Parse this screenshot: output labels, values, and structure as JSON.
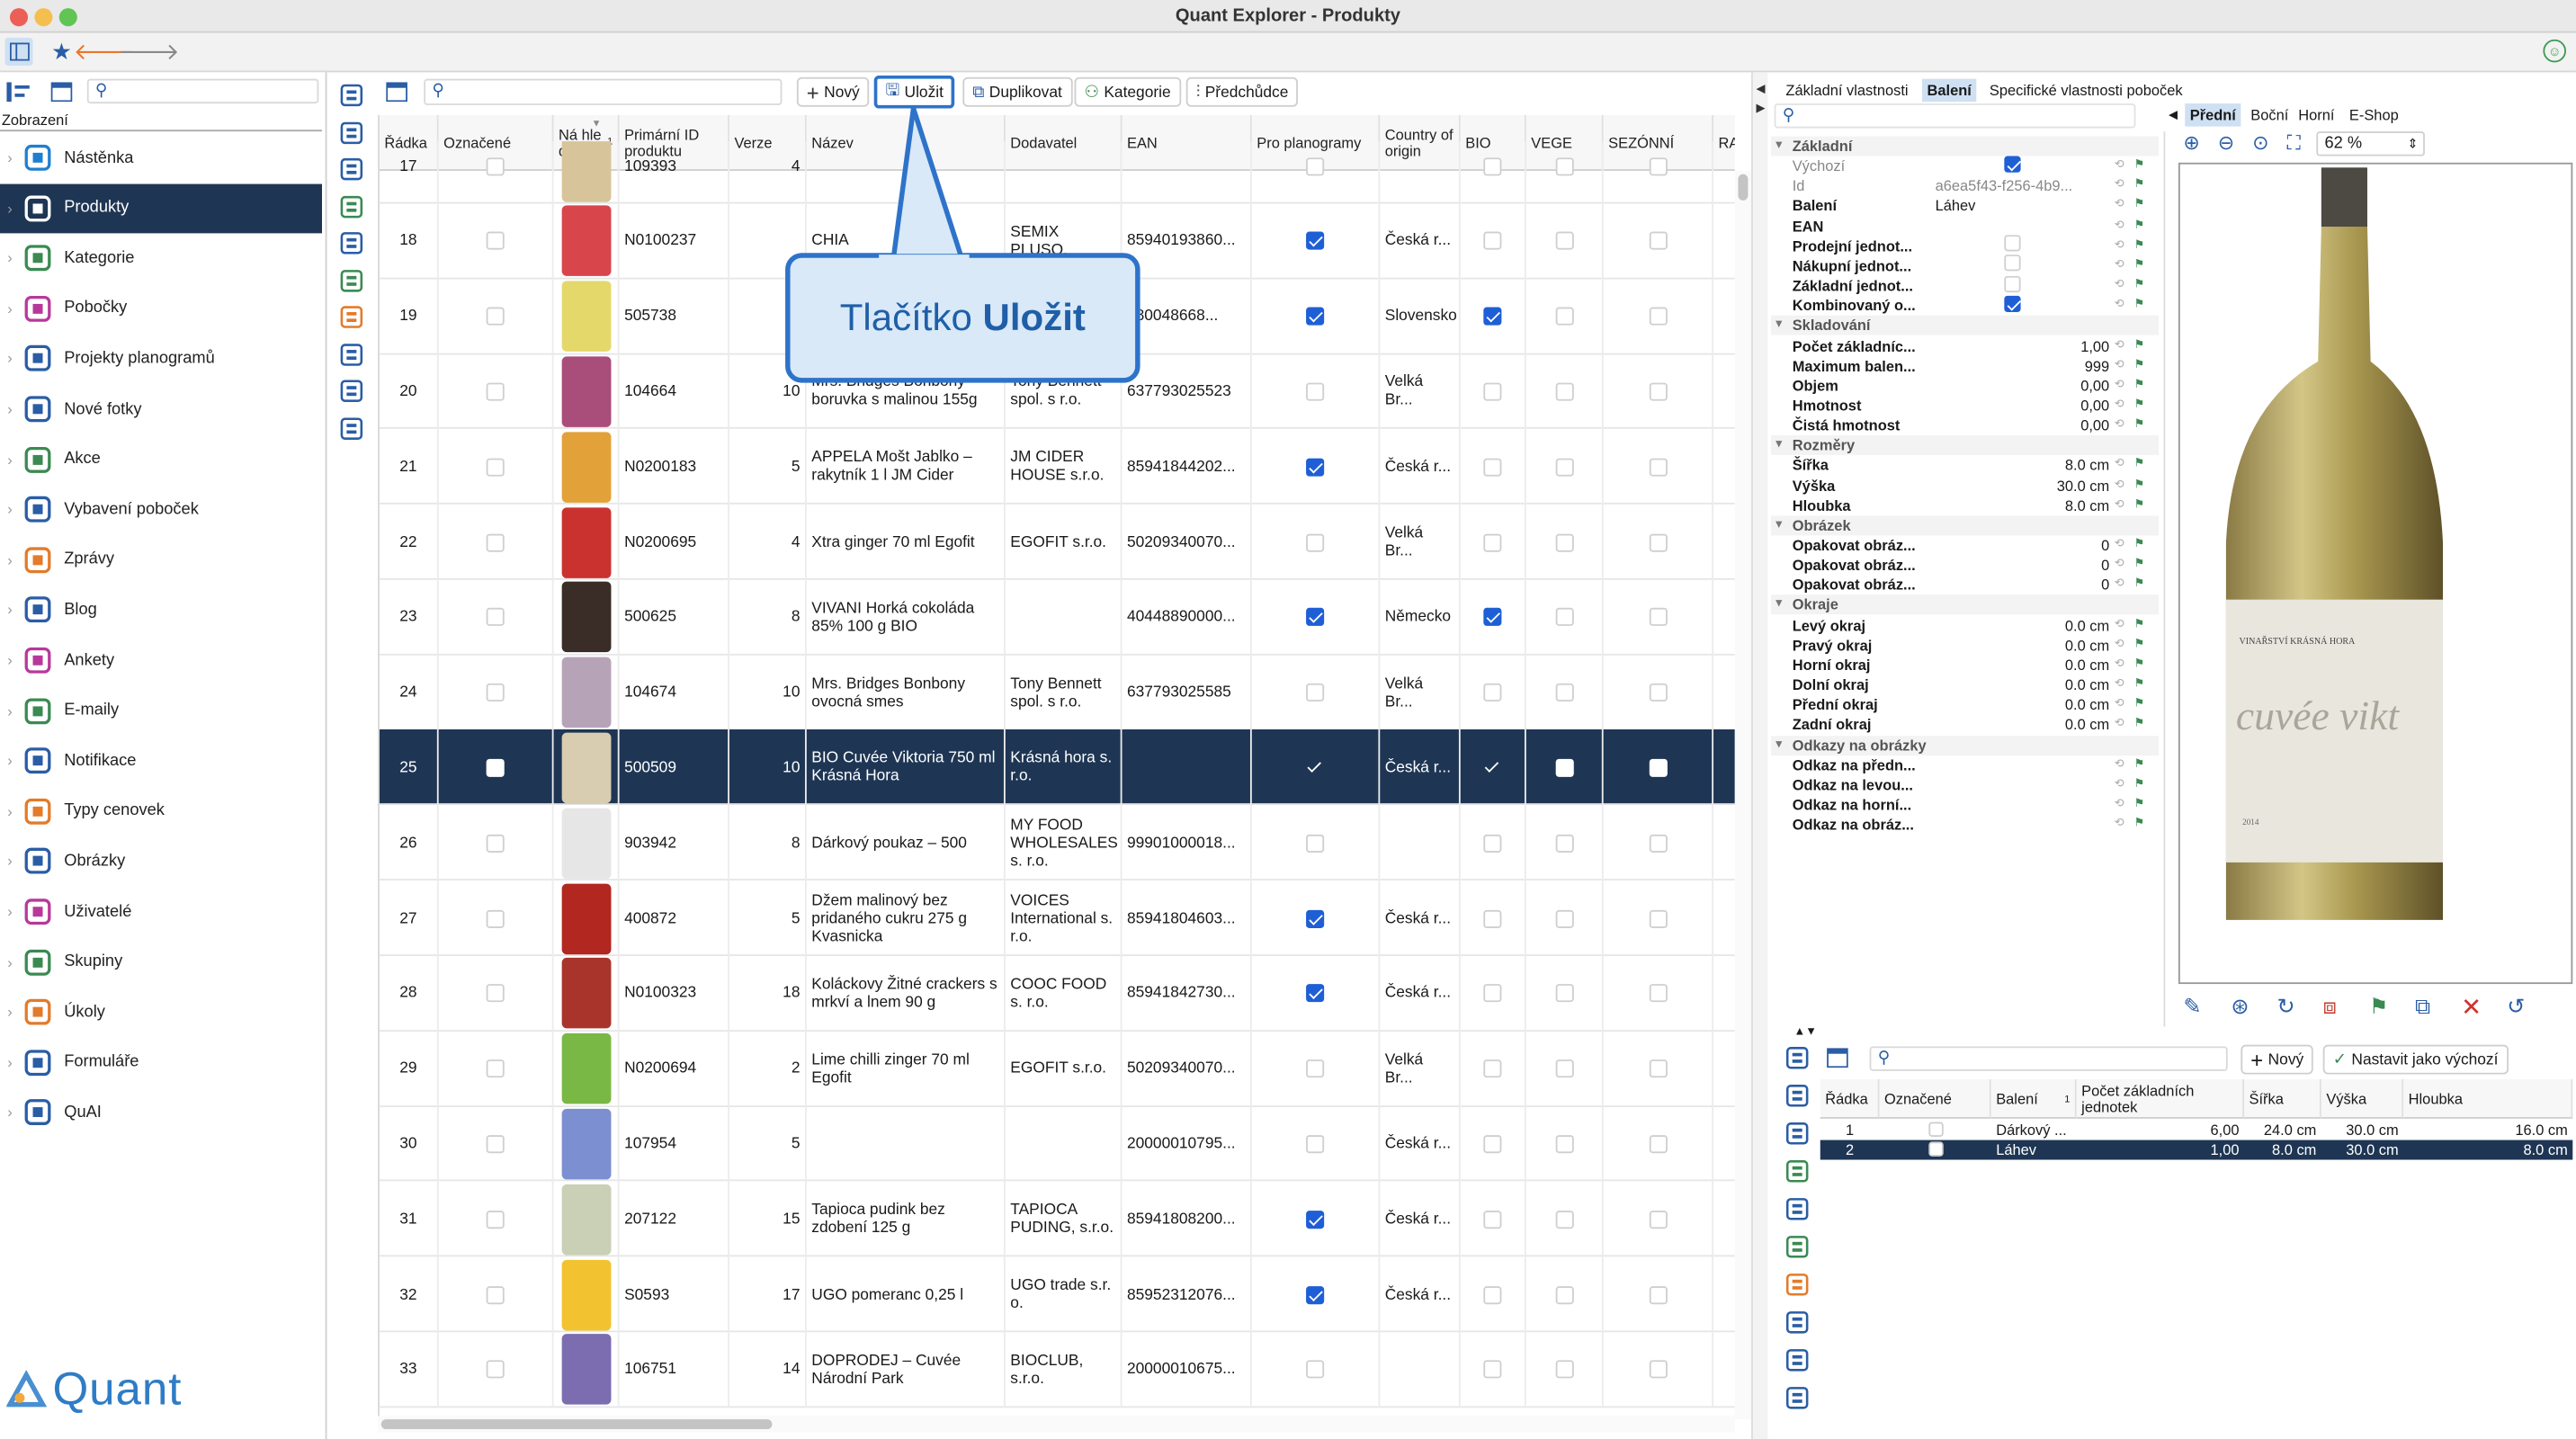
{
  "window": {
    "title": "Quant Explorer - Produkty"
  },
  "sidebar": {
    "section_label": "Zobrazení",
    "logo_text": "Quant",
    "items": [
      {
        "label": "Nástěnka",
        "icon": "dashboard-icon"
      },
      {
        "label": "Produkty",
        "icon": "products-icon",
        "selected": true
      },
      {
        "label": "Kategorie",
        "icon": "categories-icon"
      },
      {
        "label": "Pobočky",
        "icon": "branches-icon"
      },
      {
        "label": "Projekty planogramů",
        "icon": "planogram-icon"
      },
      {
        "label": "Nové fotky",
        "icon": "camera-icon"
      },
      {
        "label": "Akce",
        "icon": "promo-icon"
      },
      {
        "label": "Vybavení poboček",
        "icon": "equipment-icon"
      },
      {
        "label": "Zprávy",
        "icon": "messages-icon"
      },
      {
        "label": "Blog",
        "icon": "blog-icon"
      },
      {
        "label": "Ankety",
        "icon": "survey-icon"
      },
      {
        "label": "E-maily",
        "icon": "email-icon"
      },
      {
        "label": "Notifikace",
        "icon": "notification-icon"
      },
      {
        "label": "Typy cenovek",
        "icon": "price-tag-icon"
      },
      {
        "label": "Obrázky",
        "icon": "image-icon"
      },
      {
        "label": "Uživatelé",
        "icon": "user-icon"
      },
      {
        "label": "Skupiny",
        "icon": "group-icon"
      },
      {
        "label": "Úkoly",
        "icon": "task-icon"
      },
      {
        "label": "Formuláře",
        "icon": "form-icon"
      },
      {
        "label": "QuAI",
        "icon": "ai-icon"
      }
    ]
  },
  "toolbar": {
    "new": "Nový",
    "save": "Uložit",
    "duplicate": "Duplikovat",
    "category": "Kategorie",
    "predecessors": "Předchůdce"
  },
  "callout": {
    "prefix": "Tlačítko ",
    "bold": "Uložit"
  },
  "table": {
    "columns": [
      "Řádka",
      "Označené",
      "Ná hle d",
      "Primární ID produktu",
      "Verze",
      "Název",
      "Dodavatel",
      "EAN",
      "Pro planogramy",
      "Country of origin",
      "BIO",
      "VEGE",
      "SEZÓNNÍ",
      "RA"
    ],
    "sort_indicator": "1",
    "rows": [
      {
        "n": "17",
        "id": "109393",
        "ver": "4",
        "name": "",
        "sup": "",
        "ean": "",
        "plano": false,
        "origin": "",
        "bio": false,
        "thumb": "#d7c49a"
      },
      {
        "n": "18",
        "id": "N0100237",
        "ver": "",
        "name": "CHIA",
        "sup": "SEMIX PLUSO,",
        "ean": "85940193860...",
        "plano": true,
        "origin": "Česká r...",
        "bio": false,
        "thumb": "#d8454b"
      },
      {
        "n": "19",
        "id": "505738",
        "ver": "",
        "name": "",
        "sup": "",
        "ean": "880048668...",
        "plano": true,
        "origin": "Slovensko",
        "bio": true,
        "thumb": "#e4d86a"
      },
      {
        "n": "20",
        "id": "104664",
        "ver": "10",
        "name": "Mrs. Bridges Bonbony boruvka s malinou 155g",
        "sup": "Tony Bennett spol. s r.o.",
        "ean": "637793025523",
        "plano": false,
        "origin": "Velká Br...",
        "bio": false,
        "thumb": "#a94d7a"
      },
      {
        "n": "21",
        "id": "N0200183",
        "ver": "5",
        "name": "APPELA Mošt Jablko – rakytník 1 l JM Cider",
        "sup": "JM CIDER HOUSE s.r.o.",
        "ean": "85941844202...",
        "plano": true,
        "origin": "Česká r...",
        "bio": false,
        "thumb": "#e3a13a"
      },
      {
        "n": "22",
        "id": "N0200695",
        "ver": "4",
        "name": "Xtra ginger 70 ml Egofit",
        "sup": "EGOFIT s.r.o.",
        "ean": "50209340070...",
        "plano": false,
        "origin": "Velká Br...",
        "bio": false,
        "thumb": "#c9322f"
      },
      {
        "n": "23",
        "id": "500625",
        "ver": "8",
        "name": "VIVANI Horká cokoláda 85% 100 g BIO",
        "sup": "",
        "ean": "40448890000...",
        "plano": true,
        "origin": "Německo",
        "bio": true,
        "thumb": "#3a2c27"
      },
      {
        "n": "24",
        "id": "104674",
        "ver": "10",
        "name": "Mrs. Bridges Bonbony ovocná smes",
        "sup": "Tony Bennett spol. s r.o.",
        "ean": "637793025585",
        "plano": false,
        "origin": "Velká Br...",
        "bio": false,
        "thumb": "#b7a3b8"
      },
      {
        "n": "25",
        "id": "500509",
        "ver": "10",
        "name": "BIO Cuvée Viktoria 750 ml Krásná Hora",
        "sup": "Krásná hora s. r.o.",
        "ean": "",
        "plano": true,
        "origin": "Česká r...",
        "bio": true,
        "thumb": "#d8cdb0",
        "selected": true
      },
      {
        "n": "26",
        "id": "903942",
        "ver": "8",
        "name": "Dárkový poukaz – 500",
        "sup": "MY FOOD WHOLESALES s. r.o.",
        "ean": "99901000018...",
        "plano": false,
        "origin": "",
        "bio": false,
        "thumb": "#e6e6e6"
      },
      {
        "n": "27",
        "id": "400872",
        "ver": "5",
        "name": "Džem malinový bez pridaného cukru 275 g Kvasnicka",
        "sup": "VOICES International s. r.o.",
        "ean": "85941804603...",
        "plano": true,
        "origin": "Česká r...",
        "bio": false,
        "thumb": "#b2271f"
      },
      {
        "n": "28",
        "id": "N0100323",
        "ver": "18",
        "name": "Koláckovy Žitné crackers s mrkví a lnem 90 g",
        "sup": "COOC FOOD s. r.o.",
        "ean": "85941842730...",
        "plano": true,
        "origin": "Česká r...",
        "bio": false,
        "thumb": "#a8342c"
      },
      {
        "n": "29",
        "id": "N0200694",
        "ver": "2",
        "name": "Lime chilli zinger 70 ml Egofit",
        "sup": "EGOFIT s.r.o.",
        "ean": "50209340070...",
        "plano": false,
        "origin": "Velká Br...",
        "bio": false,
        "thumb": "#7ab845"
      },
      {
        "n": "30",
        "id": "107954",
        "ver": "5",
        "name": "",
        "sup": "",
        "ean": "20000010795...",
        "plano": false,
        "origin": "Česká r...",
        "bio": false,
        "thumb": "#7c8fd0"
      },
      {
        "n": "31",
        "id": "207122",
        "ver": "15",
        "name": "Tapioca pudink bez zdobení 125 g",
        "sup": "TAPIOCA PUDING, s.r.o.",
        "ean": "85941808200...",
        "plano": true,
        "origin": "Česká r...",
        "bio": false,
        "thumb": "#c9d0b5"
      },
      {
        "n": "32",
        "id": "S0593",
        "ver": "17",
        "name": "UGO pomeranc 0,25 l",
        "sup": "UGO trade s.r. o.",
        "ean": "85952312076...",
        "plano": true,
        "origin": "Česká r...",
        "bio": false,
        "thumb": "#f2c230"
      },
      {
        "n": "33",
        "id": "106751",
        "ver": "14",
        "name": "DOPRODEJ – Cuvée Národní Park",
        "sup": "BIOCLUB, s.r.o.",
        "ean": "20000010675...",
        "plano": false,
        "origin": "",
        "bio": false,
        "thumb": "#7b6db0"
      }
    ]
  },
  "props": {
    "tabs": [
      "Základní vlastnosti",
      "Balení",
      "Specifické vlastnosti poboček"
    ],
    "active_tab": "Balení",
    "rows": [
      {
        "g": true,
        "name": "Základní"
      },
      {
        "name": "Výchozí",
        "cb": true,
        "dim": true
      },
      {
        "name": "Id",
        "val": "a6ea5f43-f256-4b9...",
        "left": true,
        "dim": true
      },
      {
        "name": "Balení",
        "val": "Láhev",
        "left": true
      },
      {
        "name": "EAN",
        "val": ""
      },
      {
        "name": "Prodejní jednot...",
        "cb": false
      },
      {
        "name": "Nákupní jednot...",
        "cb": false
      },
      {
        "name": "Základní jednot...",
        "cb": false
      },
      {
        "name": "Kombinovaný o...",
        "cb": true
      },
      {
        "g": true,
        "name": "Skladování"
      },
      {
        "name": "Počet základníc...",
        "val": "1,00"
      },
      {
        "name": "Maximum balen...",
        "val": "999"
      },
      {
        "name": "Objem",
        "val": "0,00"
      },
      {
        "name": "Hmotnost",
        "val": "0,00"
      },
      {
        "name": "Čistá hmotnost",
        "val": "0,00"
      },
      {
        "g": true,
        "name": "Rozměry"
      },
      {
        "name": "Šířka",
        "val": "8.0 cm"
      },
      {
        "name": "Výška",
        "val": "30.0 cm"
      },
      {
        "name": "Hloubka",
        "val": "8.0 cm"
      },
      {
        "g": true,
        "name": "Obrázek"
      },
      {
        "name": "Opakovat obráz...",
        "val": "0"
      },
      {
        "name": "Opakovat obráz...",
        "val": "0"
      },
      {
        "name": "Opakovat obráz...",
        "val": "0"
      },
      {
        "g": true,
        "name": "Okraje"
      },
      {
        "name": "Levý okraj",
        "val": "0.0 cm"
      },
      {
        "name": "Pravý okraj",
        "val": "0.0 cm"
      },
      {
        "name": "Horní okraj",
        "val": "0.0 cm"
      },
      {
        "name": "Dolní okraj",
        "val": "0.0 cm"
      },
      {
        "name": "Přední okraj",
        "val": "0.0 cm"
      },
      {
        "name": "Zadní okraj",
        "val": "0.0 cm"
      },
      {
        "g": true,
        "name": "Odkazy na obrázky"
      },
      {
        "name": "Odkaz na předn...",
        "val": ""
      },
      {
        "name": "Odkaz na levou...",
        "val": ""
      },
      {
        "name": "Odkaz na horní...",
        "val": ""
      },
      {
        "name": "Odkaz na obráz...",
        "val": ""
      }
    ]
  },
  "image_panel": {
    "tabs": [
      "Přední",
      "Boční",
      "Horní",
      "E-Shop"
    ],
    "active_tab": "Přední",
    "zoom": "62 %",
    "label_brand": "VINAŘSTVÍ KRÁSNÁ HORA",
    "label_script": "cuvée vikt",
    "label_year": "2014"
  },
  "packaging": {
    "new": "Nový",
    "set_default": "Nastavit jako výchozí",
    "columns": [
      "Řádka",
      "Označené",
      "Balení",
      "Počet základních jednotek",
      "Šířka",
      "Výška",
      "Hloubka"
    ],
    "sort_indicator": "1",
    "rows": [
      {
        "n": "1",
        "pack": "Dárkový ...",
        "count": "6,00",
        "w": "24.0 cm",
        "h": "30.0 cm",
        "d": "16.0 cm"
      },
      {
        "n": "2",
        "pack": "Láhev",
        "count": "1,00",
        "w": "8.0 cm",
        "h": "30.0 cm",
        "d": "8.0 cm",
        "selected": true
      }
    ]
  },
  "colors": {
    "selection": "#1e3654",
    "accent": "#1f5fd6",
    "callout_border": "#2e73c9",
    "callout_bg": "#d9e9f8",
    "callout_text": "#1f5fa8"
  }
}
